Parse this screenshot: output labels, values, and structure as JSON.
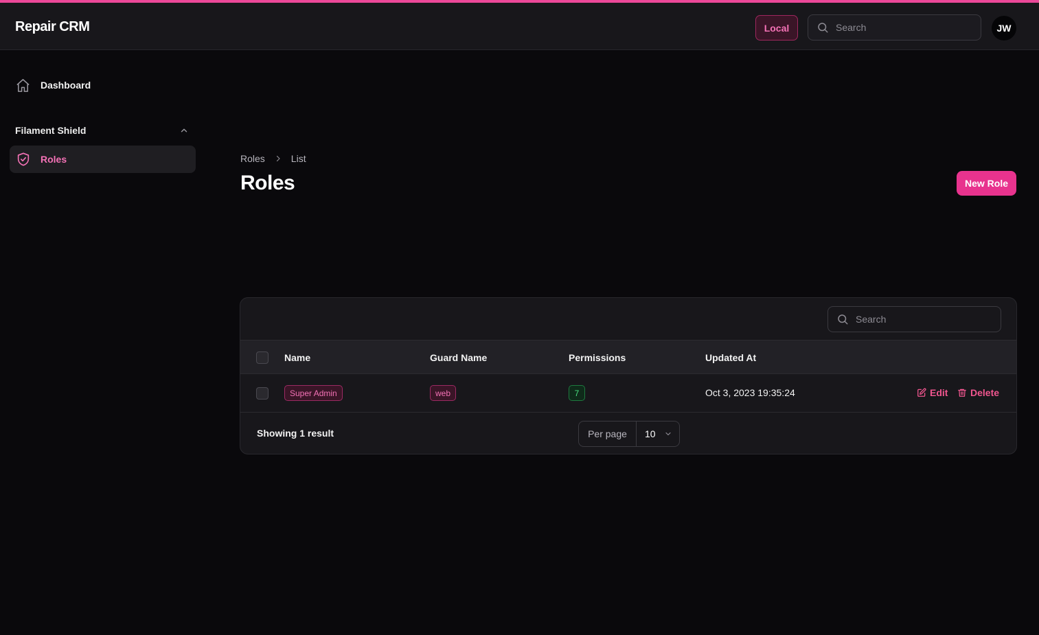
{
  "app": {
    "title": "Repair CRM",
    "environment": "Local",
    "user_initials": "JW",
    "accent_color": "#ec4899"
  },
  "topbar": {
    "search": {
      "placeholder": "Search",
      "icon": "search-icon"
    }
  },
  "sidebar": {
    "dashboard": {
      "label": "Dashboard",
      "icon": "home-icon"
    },
    "group": {
      "label": "Filament Shield",
      "icon": "chevron-up-icon",
      "expanded": true
    },
    "items": [
      {
        "label": "Roles",
        "icon": "shield-check-icon",
        "active": true
      }
    ]
  },
  "page": {
    "breadcrumb": [
      "Roles",
      "List"
    ],
    "title": "Roles",
    "new_button": "New Role"
  },
  "table": {
    "search_placeholder": "Search",
    "columns": [
      "Name",
      "Guard Name",
      "Permissions",
      "Updated At"
    ],
    "rows": [
      {
        "name": "Super Admin",
        "guard": "web",
        "permissions": "7",
        "updated_at": "Oct 3, 2023 19:35:24"
      }
    ],
    "actions": {
      "edit": "Edit",
      "delete": "Delete"
    },
    "footer": {
      "showing": "Showing 1 result",
      "per_page_label": "Per page",
      "per_page_value": "10"
    }
  }
}
